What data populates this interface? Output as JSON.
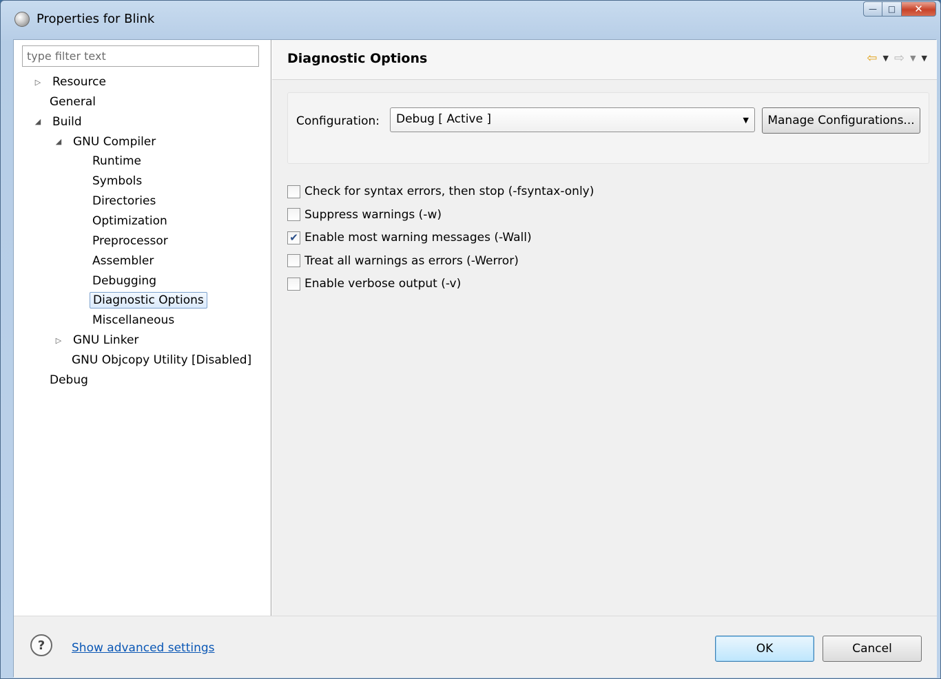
{
  "window": {
    "title": "Properties for Blink",
    "controls": {
      "minimize": "—",
      "maximize": "□",
      "close": "✕"
    }
  },
  "filter": {
    "placeholder": "type filter text"
  },
  "tree": [
    {
      "label": "Resource",
      "twisty": "▷",
      "selected": false
    },
    {
      "label": "General",
      "twisty": "",
      "selected": false
    },
    {
      "label": "Build",
      "twisty": "◢",
      "selected": false
    },
    {
      "label": "GNU Compiler",
      "twisty": "◢",
      "selected": false
    },
    {
      "label": "Runtime",
      "twisty": "",
      "selected": false
    },
    {
      "label": "Symbols",
      "twisty": "",
      "selected": false
    },
    {
      "label": "Directories",
      "twisty": "",
      "selected": false
    },
    {
      "label": "Optimization",
      "twisty": "",
      "selected": false
    },
    {
      "label": "Preprocessor",
      "twisty": "",
      "selected": false
    },
    {
      "label": "Assembler",
      "twisty": "",
      "selected": false
    },
    {
      "label": "Debugging",
      "twisty": "",
      "selected": false
    },
    {
      "label": "Diagnostic Options",
      "twisty": "",
      "selected": true
    },
    {
      "label": "Miscellaneous",
      "twisty": "",
      "selected": false
    },
    {
      "label": "GNU Linker",
      "twisty": "▷",
      "selected": false
    },
    {
      "label": "GNU Objcopy Utility  [Disabled]",
      "twisty": "",
      "selected": false
    },
    {
      "label": "Debug",
      "twisty": "",
      "selected": false
    }
  ],
  "page": {
    "title": "Diagnostic Options",
    "nav": {
      "back": "⇦",
      "forward": "⇨",
      "dropdown": "▼"
    }
  },
  "configuration": {
    "label": "Configuration:",
    "value": "Debug  [ Active ]",
    "manage_button": "Manage Configurations..."
  },
  "options": [
    {
      "label": "Check for syntax errors, then stop (-fsyntax-only)",
      "checked": false
    },
    {
      "label": "Suppress warnings (-w)",
      "checked": false
    },
    {
      "label": "Enable most warning messages (-Wall)",
      "checked": true
    },
    {
      "label": "Treat all warnings as errors (-Werror)",
      "checked": false
    },
    {
      "label": "Enable verbose output (-v)",
      "checked": false
    }
  ],
  "footer": {
    "help_symbol": "?",
    "advanced_link": "Show advanced settings",
    "ok": "OK",
    "cancel": "Cancel"
  }
}
